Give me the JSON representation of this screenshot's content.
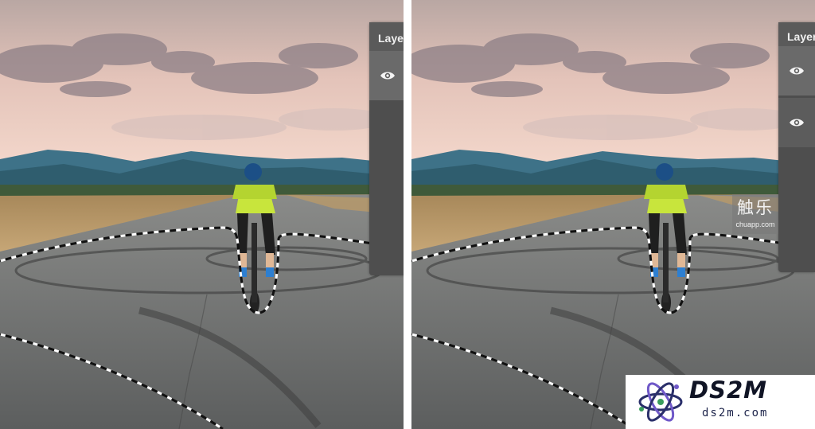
{
  "panels": {
    "left": {
      "layers_title": "Layers"
    },
    "right": {
      "layers_title": "Layers"
    }
  },
  "icons": {
    "visibility": "eye-icon",
    "logo": "atom-logo-icon"
  },
  "watermarks": {
    "site_cn": {
      "glyphs": "触乐",
      "url": "chuapp.com"
    },
    "ds2m": {
      "title": "DS2M",
      "url": "ds2m.com"
    }
  },
  "colors": {
    "panel_bg": "#4e4e4e",
    "layer_row": "#6a6a6a",
    "sky_top": "#c9b6ad",
    "sky_bottom": "#f2d0c4",
    "mountains": "#3d6f86",
    "road": "#6e7070",
    "jersey": "#c8e53c",
    "helmet": "#1c4f86",
    "logo_accent": "#6f58c8"
  }
}
